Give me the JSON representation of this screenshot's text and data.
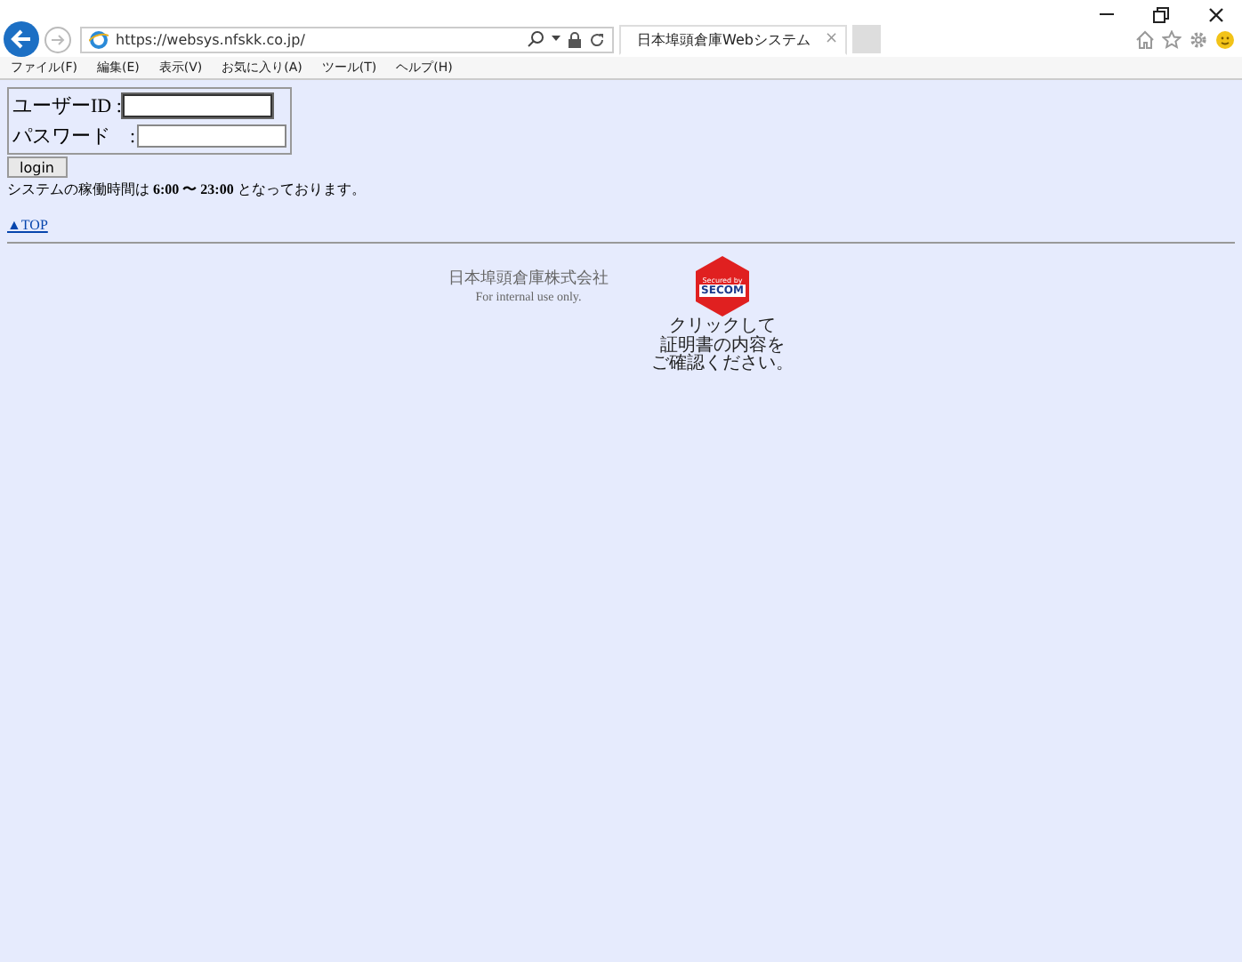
{
  "browser": {
    "address": "https://websys.nfskk.co.jp/",
    "tab": {
      "title": "日本埠頭倉庫Webシステム",
      "close": "×",
      "selected": true
    },
    "menu": [
      "ファイル(F)",
      "編集(E)",
      "表示(V)",
      "お気に入り(A)",
      "ツール(T)",
      "ヘルプ(H)"
    ]
  },
  "login": {
    "fields": [
      {
        "label": "ユーザーID :",
        "focused": true
      },
      {
        "label": "パスワード　:",
        "focused": false
      }
    ],
    "button": "login"
  },
  "notice": "システムの稼働時間は **6:00 〜 23:00** となっております。",
  "top_link": "▲TOP",
  "footer": {
    "company": "日本埠頭倉庫株式会社",
    "note": "For internal use only.",
    "seal": {
      "top": "Secured by",
      "brand": "SECOM",
      "caption": [
        "クリックして",
        "証明書の内容を",
        "ご確認ください。"
      ]
    }
  }
}
